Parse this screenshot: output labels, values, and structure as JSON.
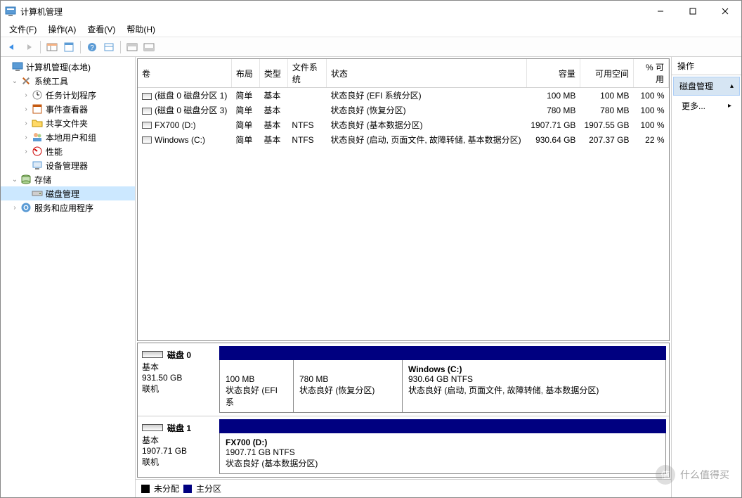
{
  "window": {
    "title": "计算机管理"
  },
  "menu": {
    "file": "文件(F)",
    "action": "操作(A)",
    "view": "查看(V)",
    "help": "帮助(H)"
  },
  "tree": {
    "root": "计算机管理(本地)",
    "systools": "系统工具",
    "sched": "任务计划程序",
    "event": "事件查看器",
    "shared": "共享文件夹",
    "users": "本地用户和组",
    "perf": "性能",
    "devmgr": "设备管理器",
    "storage": "存储",
    "diskmgmt": "磁盘管理",
    "services": "服务和应用程序"
  },
  "cols": {
    "vol": "卷",
    "layout": "布局",
    "type": "类型",
    "fs": "文件系统",
    "status": "状态",
    "cap": "容量",
    "free": "可用空间",
    "pct": "% 可用"
  },
  "vols": [
    {
      "name": "(磁盘 0 磁盘分区 1)",
      "layout": "简单",
      "type": "基本",
      "fs": "",
      "status": "状态良好 (EFI 系统分区)",
      "cap": "100 MB",
      "free": "100 MB",
      "pct": "100 %"
    },
    {
      "name": "(磁盘 0 磁盘分区 3)",
      "layout": "简单",
      "type": "基本",
      "fs": "",
      "status": "状态良好 (恢复分区)",
      "cap": "780 MB",
      "free": "780 MB",
      "pct": "100 %"
    },
    {
      "name": "FX700 (D:)",
      "layout": "简单",
      "type": "基本",
      "fs": "NTFS",
      "status": "状态良好 (基本数据分区)",
      "cap": "1907.71 GB",
      "free": "1907.55 GB",
      "pct": "100 %"
    },
    {
      "name": "Windows (C:)",
      "layout": "简单",
      "type": "基本",
      "fs": "NTFS",
      "status": "状态良好 (启动, 页面文件, 故障转储, 基本数据分区)",
      "cap": "930.64 GB",
      "free": "207.37 GB",
      "pct": "22 %"
    }
  ],
  "disks": [
    {
      "name": "磁盘 0",
      "type": "基本",
      "size": "931.50 GB",
      "online": "联机",
      "parts": [
        {
          "title": "",
          "line1": "100 MB",
          "line2": "状态良好 (EFI 系",
          "w": 105
        },
        {
          "title": "",
          "line1": "780 MB",
          "line2": "状态良好 (恢复分区)",
          "w": 155
        },
        {
          "title": "Windows  (C:)",
          "line1": "930.64 GB NTFS",
          "line2": "状态良好 (启动, 页面文件, 故障转储, 基本数据分区)",
          "w": 0
        }
      ]
    },
    {
      "name": "磁盘 1",
      "type": "基本",
      "size": "1907.71 GB",
      "online": "联机",
      "parts": [
        {
          "title": "FX700  (D:)",
          "line1": "1907.71 GB NTFS",
          "line2": "状态良好 (基本数据分区)",
          "w": 0
        }
      ]
    }
  ],
  "legend": {
    "unalloc": "未分配",
    "primary": "主分区"
  },
  "actions": {
    "header": "操作",
    "selected": "磁盘管理",
    "more": "更多..."
  },
  "watermark": "什么值得买"
}
